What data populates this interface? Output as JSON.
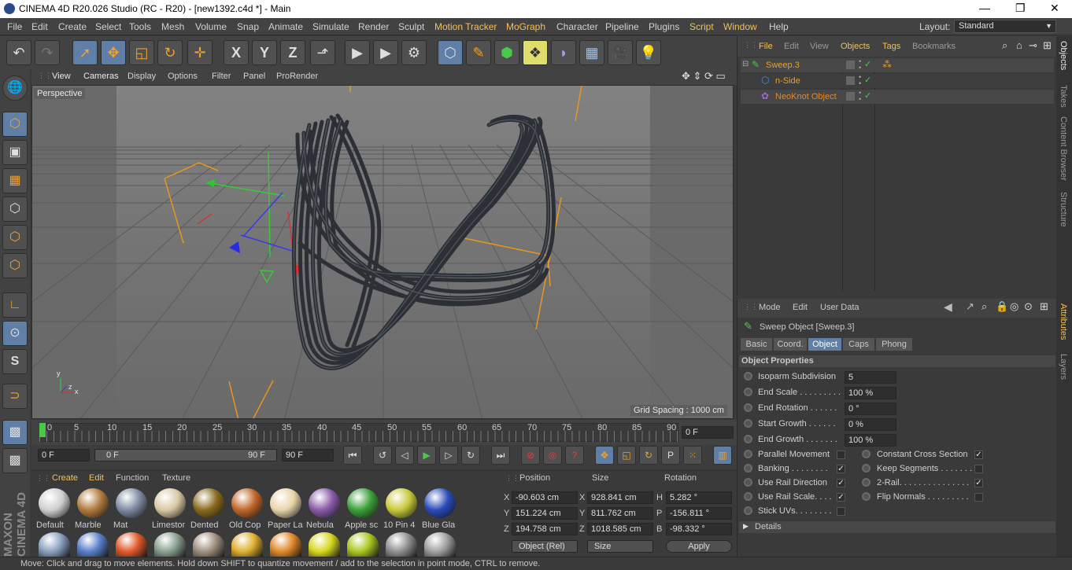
{
  "window": {
    "title": "CINEMA 4D R20.026 Studio (RC - R20) - [new1392.c4d *] - Main",
    "minimize": "—",
    "maximize": "❐",
    "close": "✕"
  },
  "menu": [
    "File",
    "Edit",
    "Create",
    "Select",
    "Tools",
    "Mesh",
    "Volume",
    "Snap",
    "Animate",
    "Simulate",
    "Render",
    "Sculpt",
    "Motion Tracker",
    "MoGraph",
    "Character",
    "Pipeline",
    "Plugins",
    "Script",
    "Window",
    "Help"
  ],
  "layout": {
    "label": "Layout:",
    "value": "Standard"
  },
  "viewport": {
    "menu": [
      "View",
      "Cameras",
      "Display",
      "Options",
      "Filter",
      "Panel",
      "ProRender"
    ],
    "camera_label": "Perspective",
    "grid_spacing": "Grid Spacing : 1000 cm"
  },
  "timeline": {
    "ticks": [
      "0",
      "5",
      "10",
      "15",
      "20",
      "25",
      "30",
      "35",
      "40",
      "45",
      "50",
      "55",
      "60",
      "65",
      "70",
      "75",
      "80",
      "85",
      "90"
    ],
    "current_frame": "0 F"
  },
  "playbar": {
    "start": "0 F",
    "min": "0 F",
    "max": "90 F",
    "end": "90 F"
  },
  "materials": {
    "menu": [
      "Create",
      "Edit",
      "Function",
      "Texture"
    ],
    "items": [
      {
        "name": "Default",
        "color": "#cfcfcf"
      },
      {
        "name": "Marble",
        "color": "#b07a3c"
      },
      {
        "name": "Mat",
        "color": "#7d8aa0"
      },
      {
        "name": "Limestor",
        "color": "#d8c8a4"
      },
      {
        "name": "Dented",
        "color": "#8a6a1c"
      },
      {
        "name": "Old Cop",
        "color": "#c06628"
      },
      {
        "name": "Paper La",
        "color": "#e8d4a8"
      },
      {
        "name": "Nebula",
        "color": "#8a5aa8"
      },
      {
        "name": "Apple sc",
        "color": "#3aa03a"
      },
      {
        "name": "10 Pin 4",
        "color": "#c8c83a"
      },
      {
        "name": "Blue Gla",
        "color": "#2a4ab8"
      }
    ],
    "row2_colors": [
      "#8aa0c0",
      "#5a80c8",
      "#e05a2a",
      "#8aa090",
      "#a09080",
      "#e0b030",
      "#e08a2a",
      "#d8d820",
      "#a8c820",
      "#909090",
      "#a0a0a0"
    ]
  },
  "coords": {
    "headers": [
      "Position",
      "Size",
      "Rotation"
    ],
    "rows": [
      {
        "axis": "X",
        "pos": "-90.603 cm",
        "saxis": "X",
        "size": "928.841 cm",
        "raxis": "H",
        "rot": "5.282 °"
      },
      {
        "axis": "Y",
        "pos": "151.224 cm",
        "saxis": "Y",
        "size": "811.762 cm",
        "raxis": "P",
        "rot": "-156.811 °"
      },
      {
        "axis": "Z",
        "pos": "194.758 cm",
        "saxis": "Z",
        "size": "1018.585 cm",
        "raxis": "B",
        "rot": "-98.332 °"
      }
    ],
    "mode": "Object (Rel)",
    "size_mode": "Size",
    "apply": "Apply"
  },
  "objects": {
    "menu": [
      "File",
      "Edit",
      "View",
      "Objects",
      "Tags",
      "Bookmarks"
    ],
    "items": [
      {
        "name": "Sweep.3",
        "color": "#f0a020"
      },
      {
        "name": "n-Side",
        "color": "#f0a020"
      },
      {
        "name": "NeoKnot Object",
        "color": "#e08a2a"
      }
    ]
  },
  "attributes": {
    "menu": [
      "Mode",
      "Edit",
      "User Data"
    ],
    "object_title": "Sweep Object [Sweep.3]",
    "tabs": [
      "Basic",
      "Coord.",
      "Object",
      "Caps",
      "Phong"
    ],
    "active_tab": "Object",
    "section": "Object Properties",
    "props": [
      {
        "label": "Isoparm Subdivision",
        "value": "5"
      },
      {
        "label": "End Scale . . . . . . . . .",
        "value": "100 %"
      },
      {
        "label": "End Rotation . . . . . .",
        "value": "0 °"
      },
      {
        "label": "Start Growth . . . . . .",
        "value": "0 %"
      },
      {
        "label": "End Growth . . . . . . .",
        "value": "100 %"
      }
    ],
    "checks_left": [
      {
        "label": "Parallel Movement",
        "checked": false
      },
      {
        "label": "Banking . . . . . . . .",
        "checked": true
      },
      {
        "label": "Use Rail Direction",
        "checked": true
      },
      {
        "label": "Use Rail Scale. . . .",
        "checked": true
      },
      {
        "label": "Stick UVs. . . . . . . .",
        "checked": false
      }
    ],
    "checks_right": [
      {
        "label": "Constant Cross Section",
        "checked": true
      },
      {
        "label": "Keep Segments . . . . . . .",
        "checked": false
      },
      {
        "label": "2-Rail. . . . . . . . . . . . . . .",
        "checked": true
      },
      {
        "label": "Flip Normals . . . . . . . . .",
        "checked": false
      }
    ],
    "details": "Details"
  },
  "right_tabs": [
    "Objects",
    "Takes",
    "Content Browser",
    "Structure",
    "Attributes",
    "Layers"
  ],
  "status": "Move: Click and drag to move elements. Hold down SHIFT to quantize movement / add to the selection in point mode, CTRL to remove."
}
